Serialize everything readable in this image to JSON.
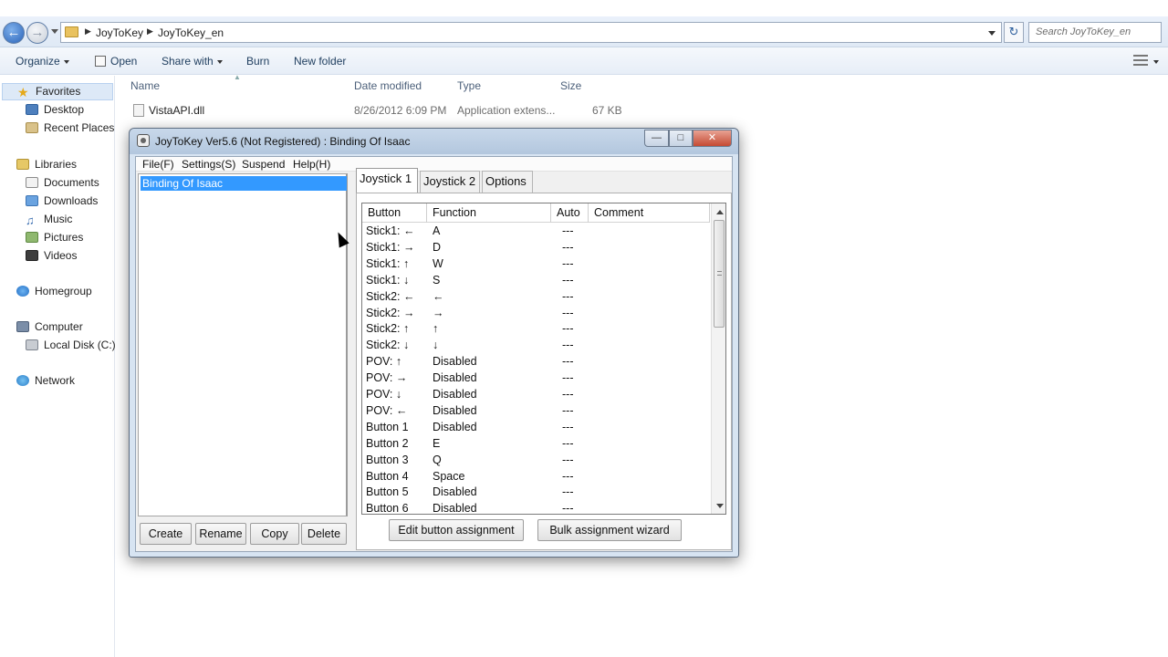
{
  "explorer": {
    "breadcrumb": [
      "JoyToKey",
      "JoyToKey_en"
    ],
    "search_placeholder": "Search JoyToKey_en",
    "toolbar": {
      "organize": "Organize",
      "open": "Open",
      "share_with": "Share with",
      "burn": "Burn",
      "new_folder": "New folder"
    },
    "nav": {
      "favorites": "Favorites",
      "desktop": "Desktop",
      "recent_places": "Recent Places",
      "libraries": "Libraries",
      "documents": "Documents",
      "downloads": "Downloads",
      "music": "Music",
      "pictures": "Pictures",
      "videos": "Videos",
      "homegroup": "Homegroup",
      "computer": "Computer",
      "local_disk": "Local Disk (C:)",
      "network": "Network"
    },
    "columns": {
      "name": "Name",
      "date_modified": "Date modified",
      "type": "Type",
      "size": "Size"
    },
    "files": [
      {
        "name": "VistaAPI.dll",
        "date": "8/26/2012 6:09 PM",
        "type": "Application extens...",
        "size": "67 KB"
      }
    ]
  },
  "joytokey": {
    "title": "JoyToKey Ver5.6 (Not Registered) : Binding Of Isaac",
    "window_buttons": {
      "minimize": "—",
      "maximize": "□",
      "close": "✕"
    },
    "menu": [
      "File(F)",
      "Settings(S)",
      "Suspend",
      "Help(H)"
    ],
    "configs": [
      "Binding Of Isaac"
    ],
    "config_buttons": {
      "create": "Create",
      "rename": "Rename",
      "copy": "Copy",
      "delete": "Delete"
    },
    "tabs": [
      "Joystick 1",
      "Joystick 2",
      "Options"
    ],
    "active_tab": "Joystick 1",
    "grid_columns": {
      "button": "Button",
      "function": "Function",
      "auto": "Auto",
      "comment": "Comment"
    },
    "rows": [
      {
        "button": "Stick1: ←",
        "function": "A",
        "auto": "---",
        "comment": ""
      },
      {
        "button": "Stick1: →",
        "function": "D",
        "auto": "---",
        "comment": ""
      },
      {
        "button": "Stick1: ↑",
        "function": "W",
        "auto": "---",
        "comment": ""
      },
      {
        "button": "Stick1: ↓",
        "function": "S",
        "auto": "---",
        "comment": ""
      },
      {
        "button": "Stick2: ←",
        "function": "←",
        "auto": "---",
        "comment": ""
      },
      {
        "button": "Stick2: →",
        "function": "→",
        "auto": "---",
        "comment": ""
      },
      {
        "button": "Stick2: ↑",
        "function": "↑",
        "auto": "---",
        "comment": ""
      },
      {
        "button": "Stick2: ↓",
        "function": "↓",
        "auto": "---",
        "comment": ""
      },
      {
        "button": "POV: ↑",
        "function": "Disabled",
        "auto": "---",
        "comment": ""
      },
      {
        "button": "POV: →",
        "function": "Disabled",
        "auto": "---",
        "comment": ""
      },
      {
        "button": "POV: ↓",
        "function": "Disabled",
        "auto": "---",
        "comment": ""
      },
      {
        "button": "POV: ←",
        "function": "Disabled",
        "auto": "---",
        "comment": ""
      },
      {
        "button": "Button 1",
        "function": "Disabled",
        "auto": "---",
        "comment": ""
      },
      {
        "button": "Button 2",
        "function": "E",
        "auto": "---",
        "comment": ""
      },
      {
        "button": "Button 3",
        "function": "Q",
        "auto": "---",
        "comment": ""
      },
      {
        "button": "Button 4",
        "function": "Space",
        "auto": "---",
        "comment": ""
      },
      {
        "button": "Button 5",
        "function": "Disabled",
        "auto": "---",
        "comment": ""
      },
      {
        "button": "Button 6",
        "function": "Disabled",
        "auto": "---",
        "comment": ""
      }
    ],
    "action_buttons": {
      "edit": "Edit button assignment",
      "bulk": "Bulk assignment wizard"
    }
  }
}
